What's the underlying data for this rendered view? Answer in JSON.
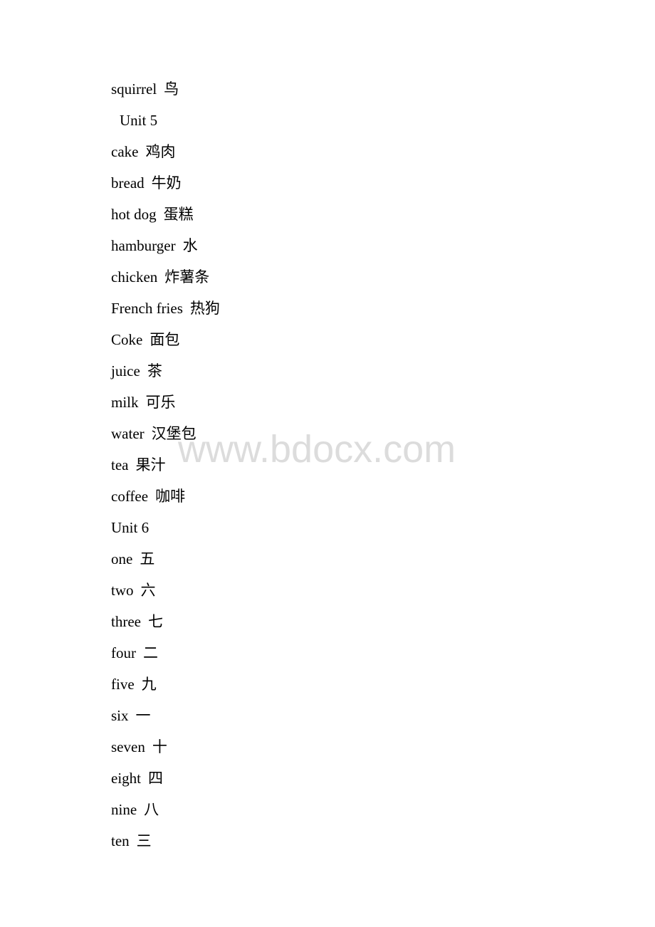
{
  "document": {
    "lines": [
      {
        "en": "squirrel",
        "zh": "鸟"
      },
      {
        "heading": "Unit 5"
      },
      {
        "en": "cake",
        "zh": "鸡肉"
      },
      {
        "en": "bread",
        "zh": "牛奶"
      },
      {
        "en": "hot dog",
        "zh": "蛋糕"
      },
      {
        "en": "hamburger",
        "zh": "水"
      },
      {
        "en": "chicken",
        "zh": "炸薯条"
      },
      {
        "en": "French fries",
        "zh": "热狗"
      },
      {
        "en": "Coke",
        "zh": "面包"
      },
      {
        "en": "juice",
        "zh": "茶"
      },
      {
        "en": "milk",
        "zh": "可乐"
      },
      {
        "en": "water",
        "zh": "汉堡包"
      },
      {
        "en": "tea",
        "zh": "果汁"
      },
      {
        "en": "coffee",
        "zh": "咖啡"
      },
      {
        "heading": "Unit 6"
      },
      {
        "en": "one",
        "zh": "五"
      },
      {
        "en": "two",
        "zh": "六"
      },
      {
        "en": "three",
        "zh": "七"
      },
      {
        "en": "four",
        "zh": "二"
      },
      {
        "en": "five",
        "zh": "九"
      },
      {
        "en": "six",
        "zh": "一"
      },
      {
        "en": "seven",
        "zh": "十"
      },
      {
        "en": "eight",
        "zh": "四"
      },
      {
        "en": "nine",
        "zh": "八"
      },
      {
        "en": "ten",
        "zh": "三"
      }
    ]
  },
  "watermark": {
    "text": "www.bdocx.com",
    "color": "#dcdcdc"
  }
}
